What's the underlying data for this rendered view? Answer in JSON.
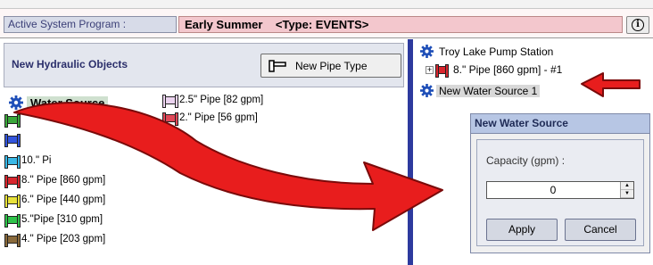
{
  "program_bar": {
    "label": "Active System Program :",
    "program_name": "Early Summer    <Type: EVENTS>",
    "info_icon": "info-icon"
  },
  "left_panel": {
    "title": "New Hydraulic Objects",
    "new_pipe_button": "New Pipe Type",
    "water_source": "Water Source",
    "pipes_col1": [
      {
        "label": "",
        "color": "#3aa83a"
      },
      {
        "label": "",
        "color": "#3355dd"
      },
      {
        "label": "10.\" Pi",
        "color": "#38b8e6"
      },
      {
        "label": "8.\" Pipe [860 gpm]",
        "color": "#d9262e"
      },
      {
        "label": "6.\" Pipe [440 gpm]",
        "color": "#e8e23a"
      },
      {
        "label": "5.\"Pipe [310 gpm]",
        "color": "#2fc44a"
      },
      {
        "label": "4.\" Pipe [203 gpm]",
        "color": "#8a6a3b"
      }
    ],
    "pipes_col2": [
      {
        "label": "2.5\" Pipe [82 gpm]",
        "color": "#ecd4f0"
      },
      {
        "label": "2.\" Pipe [56 gpm]",
        "color": "#e04858"
      }
    ]
  },
  "right_panel": {
    "tree": [
      {
        "label": "Troy Lake Pump Station"
      },
      {
        "label": "8.\" Pipe [860 gpm] - #1",
        "color": "#d9262e"
      },
      {
        "label": "New Water Source 1"
      }
    ]
  },
  "dialog": {
    "title": "New Water Source",
    "capacity_label": "Capacity (gpm) :",
    "capacity_value": "0",
    "apply": "Apply",
    "cancel": "Cancel"
  },
  "colors": {
    "arrow_red": "#e81d1d",
    "divider_blue": "#2d3a9e",
    "program_pink": "#f3c7cd",
    "gear_blue": "#1f4fb8"
  }
}
